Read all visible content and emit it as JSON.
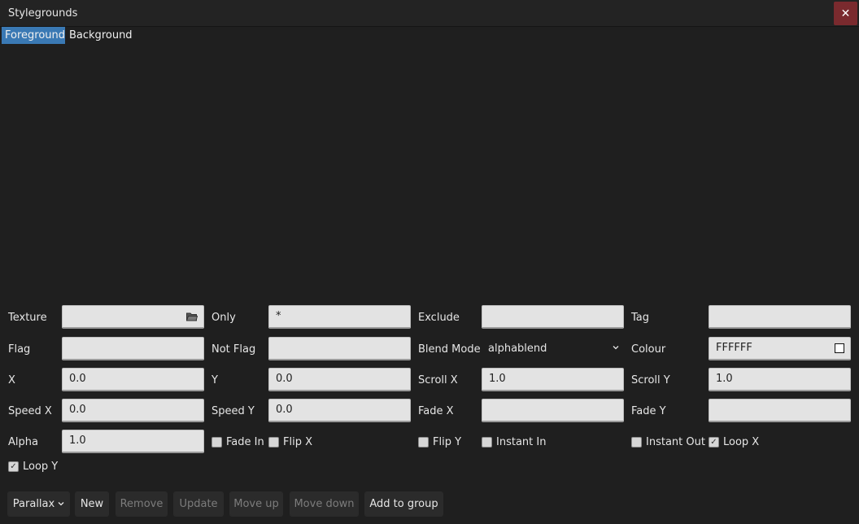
{
  "window": {
    "title": "Stylegrounds",
    "close_label": "✕"
  },
  "tabs": [
    {
      "label": "Foreground",
      "selected": true
    },
    {
      "label": "Background",
      "selected": false
    }
  ],
  "form": {
    "texture": {
      "label": "Texture",
      "value": "",
      "icon": "folder-open-icon"
    },
    "only": {
      "label": "Only",
      "value": "*"
    },
    "exclude": {
      "label": "Exclude",
      "value": ""
    },
    "tag": {
      "label": "Tag",
      "value": ""
    },
    "flag": {
      "label": "Flag",
      "value": ""
    },
    "not_flag": {
      "label": "Not Flag",
      "value": ""
    },
    "blend_mode": {
      "label": "Blend Mode",
      "value": "alphablend",
      "icon": "chevron-down-icon"
    },
    "colour": {
      "label": "Colour",
      "value": "FFFFFF",
      "swatch": "#FFFFFF"
    },
    "x": {
      "label": "X",
      "value": "0.0"
    },
    "y": {
      "label": "Y",
      "value": "0.0"
    },
    "scroll_x": {
      "label": "Scroll X",
      "value": "1.0"
    },
    "scroll_y": {
      "label": "Scroll Y",
      "value": "1.0"
    },
    "speed_x": {
      "label": "Speed X",
      "value": "0.0"
    },
    "speed_y": {
      "label": "Speed Y",
      "value": "0.0"
    },
    "fade_x": {
      "label": "Fade X",
      "value": ""
    },
    "fade_y": {
      "label": "Fade Y",
      "value": ""
    },
    "alpha": {
      "label": "Alpha",
      "value": "1.0"
    }
  },
  "checkboxes": {
    "fade_in": {
      "label": "Fade In",
      "checked": false
    },
    "flip_x": {
      "label": "Flip X",
      "checked": false
    },
    "flip_y": {
      "label": "Flip Y",
      "checked": false
    },
    "instant_in": {
      "label": "Instant In",
      "checked": false
    },
    "instant_out": {
      "label": "Instant Out",
      "checked": false
    },
    "loop_x": {
      "label": "Loop X",
      "checked": true
    },
    "loop_y": {
      "label": "Loop Y",
      "checked": true
    }
  },
  "buttons": {
    "parallax": "Parallax",
    "new": "New",
    "remove": "Remove",
    "update": "Update",
    "move_up": "Move up",
    "move_down": "Move down",
    "add_to_group": "Add to group"
  },
  "colors": {
    "background": "#1f1f1f",
    "accent": "#3a79b4",
    "close": "#7a2a2e",
    "field": "#e3e3e3"
  }
}
